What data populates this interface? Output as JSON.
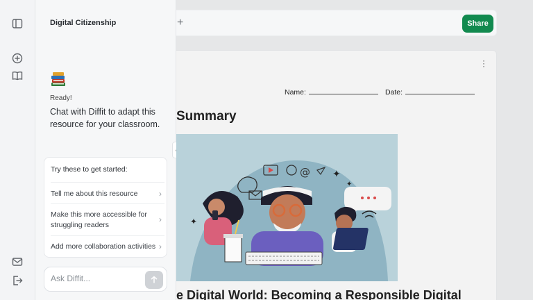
{
  "panel": {
    "title": "Digital Citizenship",
    "ready": "Ready!",
    "intro": "Chat with Diffit to adapt this resource for your classroom.",
    "suggestions_heading": "Try these to get started:",
    "suggestions": [
      "Tell me about this resource",
      "Make this more accessible for struggling readers",
      "Add more collaboration activities"
    ],
    "ask_placeholder": "Ask Diffit..."
  },
  "topbar": {
    "share_label": "Share"
  },
  "document": {
    "name_label": "Name:",
    "date_label": "Date:",
    "heading": "Summary",
    "subheading": "e Digital World: Becoming a Responsible Digital"
  },
  "colors": {
    "share_green": "#128a4f",
    "hero_bg": "#b9d2da"
  }
}
